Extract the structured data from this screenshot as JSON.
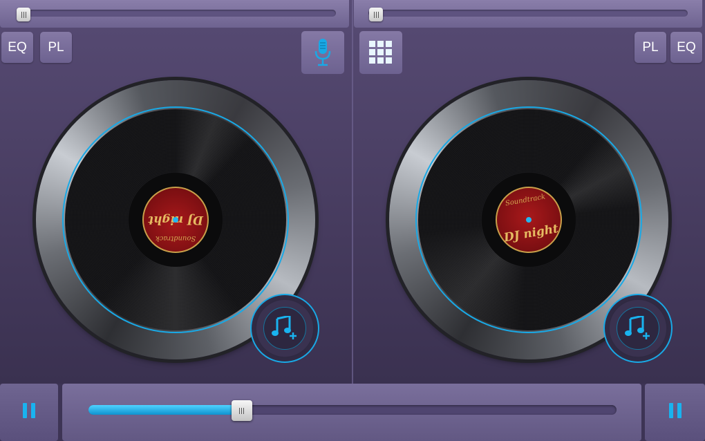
{
  "left_deck": {
    "pitch_slider_value": 0.0,
    "eq_label": "EQ",
    "playlist_label": "PL",
    "mic_icon": "microphone-icon",
    "record": {
      "title": "DJ night",
      "subtitle": "Soundtrack"
    },
    "add_track_icon": "music-note-plus-icon",
    "play_state_icon": "pause-icon"
  },
  "right_deck": {
    "pitch_slider_value": 0.0,
    "eq_label": "EQ",
    "playlist_label": "PL",
    "grid_icon": "grid-icon",
    "record": {
      "title": "DJ night",
      "subtitle": "Soundtrack"
    },
    "add_track_icon": "music-note-plus-icon",
    "play_state_icon": "pause-icon"
  },
  "crossfader": {
    "value_percent": 29
  },
  "colors": {
    "accent": "#19a9e6",
    "label_red": "#8c1215",
    "label_gold": "#e5bb62"
  }
}
